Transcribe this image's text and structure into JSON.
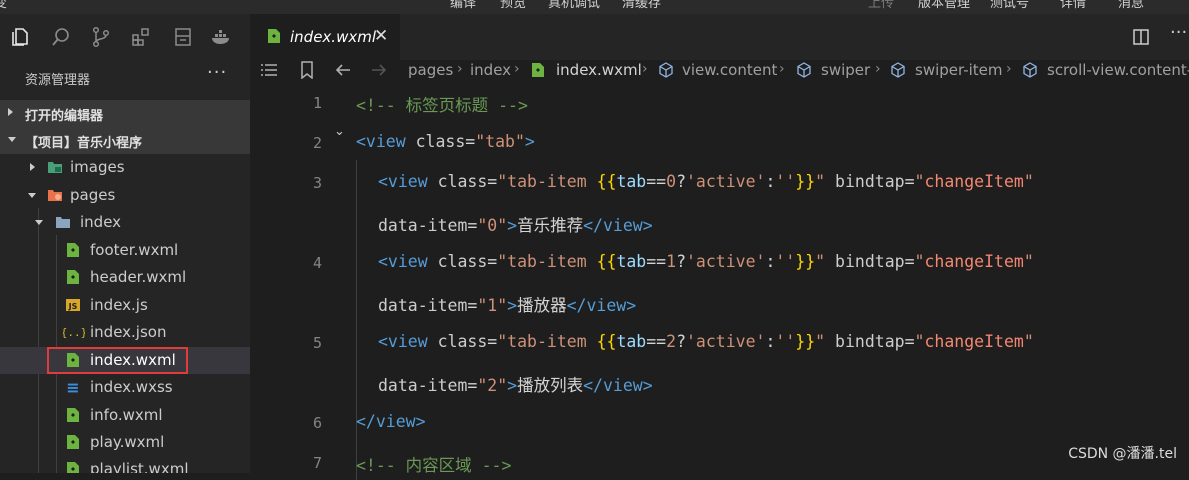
{
  "menu": {
    "items": [
      "变",
      "编译",
      "预览",
      "真机调试",
      "清缓存",
      "上传",
      "版本管理",
      "测试号",
      "详情",
      "消息"
    ]
  },
  "activity_icons": [
    "files-icon",
    "search-icon",
    "source-control-icon",
    "extensions-icon",
    "packages-icon",
    "docker-icon"
  ],
  "sidebar": {
    "title": "资源管理器",
    "more": "···",
    "sections": [
      {
        "label": "打开的编辑器",
        "expanded": false
      },
      {
        "label": "【项目】音乐小程序",
        "expanded": true
      }
    ],
    "tree": [
      {
        "label": "images",
        "type": "folder-images",
        "expanded": false
      },
      {
        "label": "pages",
        "type": "folder-pages",
        "expanded": true
      },
      {
        "label": "index",
        "type": "folder",
        "expanded": true
      },
      {
        "label": "footer.wxml",
        "type": "wxml"
      },
      {
        "label": "header.wxml",
        "type": "wxml"
      },
      {
        "label": "index.js",
        "type": "js"
      },
      {
        "label": "index.json",
        "type": "json"
      },
      {
        "label": "index.wxml",
        "type": "wxml",
        "selected": true
      },
      {
        "label": "index.wxss",
        "type": "wxss"
      },
      {
        "label": "info.wxml",
        "type": "wxml"
      },
      {
        "label": "play.wxml",
        "type": "wxml"
      },
      {
        "label": "playlist.wxml",
        "type": "wxml"
      }
    ],
    "icon_text": {
      "js": "JS",
      "json": "{..}",
      "wxss": "≡"
    }
  },
  "tabs": [
    {
      "label": "index.wxml",
      "active": true,
      "close": "✕"
    }
  ],
  "editor_actions": {
    "split": "split-editor-icon",
    "more": "···"
  },
  "breadcrumb": [
    "pages",
    "index",
    "index.wxml",
    "view.content",
    "swiper",
    "swiper-item",
    "scroll-view.content-"
  ],
  "breadcrumb_sep": "›",
  "code": {
    "line_numbers": [
      "1",
      "2",
      "3",
      "",
      "4",
      "",
      "5",
      "",
      "6",
      "7"
    ],
    "lines": [
      {
        "tokens": [
          {
            "c": "cm",
            "t": "<!-- 标签页标题 -->"
          }
        ]
      },
      {
        "tokens": [
          {
            "c": "tg",
            "t": "<view"
          },
          {
            "c": "at",
            "t": " class"
          },
          {
            "c": "eq",
            "t": "="
          },
          {
            "c": "st",
            "t": "\"tab\""
          },
          {
            "c": "tg",
            "t": ">"
          }
        ]
      },
      {
        "tokens": [
          {
            "c": "tg",
            "t": "<view"
          },
          {
            "c": "at",
            "t": " class"
          },
          {
            "c": "eq",
            "t": "="
          },
          {
            "c": "st",
            "t": "\"tab-item "
          },
          {
            "c": "br",
            "t": "{{"
          },
          {
            "c": "vr",
            "t": "tab"
          },
          {
            "c": "eq",
            "t": "=="
          },
          {
            "c": "st",
            "t": "0"
          },
          {
            "c": "eq",
            "t": "?"
          },
          {
            "c": "st",
            "t": "'active'"
          },
          {
            "c": "eq",
            "t": ":"
          },
          {
            "c": "st",
            "t": "''"
          },
          {
            "c": "br",
            "t": "}}"
          },
          {
            "c": "st",
            "t": "\""
          },
          {
            "c": "at",
            "t": " bindtap"
          },
          {
            "c": "eq",
            "t": "="
          },
          {
            "c": "st",
            "t": "\""
          },
          {
            "c": "fn",
            "t": "changeItem"
          },
          {
            "c": "st",
            "t": "\""
          }
        ]
      },
      {
        "tokens": [
          {
            "c": "at",
            "t": "data-item"
          },
          {
            "c": "eq",
            "t": "="
          },
          {
            "c": "st",
            "t": "\"0\""
          },
          {
            "c": "tg",
            "t": ">"
          },
          {
            "c": "tx",
            "t": "音乐推荐"
          },
          {
            "c": "tg",
            "t": "</view>"
          }
        ]
      },
      {
        "tokens": [
          {
            "c": "tg",
            "t": "<view"
          },
          {
            "c": "at",
            "t": " class"
          },
          {
            "c": "eq",
            "t": "="
          },
          {
            "c": "st",
            "t": "\"tab-item "
          },
          {
            "c": "br",
            "t": "{{"
          },
          {
            "c": "vr",
            "t": "tab"
          },
          {
            "c": "eq",
            "t": "=="
          },
          {
            "c": "st",
            "t": "1"
          },
          {
            "c": "eq",
            "t": "?"
          },
          {
            "c": "st",
            "t": "'active'"
          },
          {
            "c": "eq",
            "t": ":"
          },
          {
            "c": "st",
            "t": "''"
          },
          {
            "c": "br",
            "t": "}}"
          },
          {
            "c": "st",
            "t": "\""
          },
          {
            "c": "at",
            "t": " bindtap"
          },
          {
            "c": "eq",
            "t": "="
          },
          {
            "c": "st",
            "t": "\""
          },
          {
            "c": "fn",
            "t": "changeItem"
          },
          {
            "c": "st",
            "t": "\""
          }
        ]
      },
      {
        "tokens": [
          {
            "c": "at",
            "t": "data-item"
          },
          {
            "c": "eq",
            "t": "="
          },
          {
            "c": "st",
            "t": "\"1\""
          },
          {
            "c": "tg",
            "t": ">"
          },
          {
            "c": "tx",
            "t": "播放器"
          },
          {
            "c": "tg",
            "t": "</view>"
          }
        ]
      },
      {
        "tokens": [
          {
            "c": "tg",
            "t": "<view"
          },
          {
            "c": "at",
            "t": " class"
          },
          {
            "c": "eq",
            "t": "="
          },
          {
            "c": "st",
            "t": "\"tab-item "
          },
          {
            "c": "br",
            "t": "{{"
          },
          {
            "c": "vr",
            "t": "tab"
          },
          {
            "c": "eq",
            "t": "=="
          },
          {
            "c": "st",
            "t": "2"
          },
          {
            "c": "eq",
            "t": "?"
          },
          {
            "c": "st",
            "t": "'active'"
          },
          {
            "c": "eq",
            "t": ":"
          },
          {
            "c": "st",
            "t": "''"
          },
          {
            "c": "br",
            "t": "}}"
          },
          {
            "c": "st",
            "t": "\""
          },
          {
            "c": "at",
            "t": " bindtap"
          },
          {
            "c": "eq",
            "t": "="
          },
          {
            "c": "st",
            "t": "\""
          },
          {
            "c": "fn",
            "t": "changeItem"
          },
          {
            "c": "st",
            "t": "\""
          }
        ]
      },
      {
        "tokens": [
          {
            "c": "at",
            "t": "data-item"
          },
          {
            "c": "eq",
            "t": "="
          },
          {
            "c": "st",
            "t": "\"2\""
          },
          {
            "c": "tg",
            "t": ">"
          },
          {
            "c": "tx",
            "t": "播放列表"
          },
          {
            "c": "tg",
            "t": "</view>"
          }
        ]
      },
      {
        "tokens": [
          {
            "c": "tg",
            "t": "</view>"
          }
        ]
      },
      {
        "tokens": [
          {
            "c": "cm",
            "t": "<!-- 内容区域 -->"
          }
        ]
      }
    ]
  },
  "watermark": "CSDN @潘潘.tel",
  "colors": {
    "background": "#1e1e1e",
    "sidebar": "#252526",
    "selection_outline": "#e03c3c",
    "comment": "#6a9955",
    "tag": "#569cd6",
    "string": "#ce9178",
    "bracket": "#ffd700",
    "variable": "#9cdcfe",
    "handler": "#f48771"
  }
}
